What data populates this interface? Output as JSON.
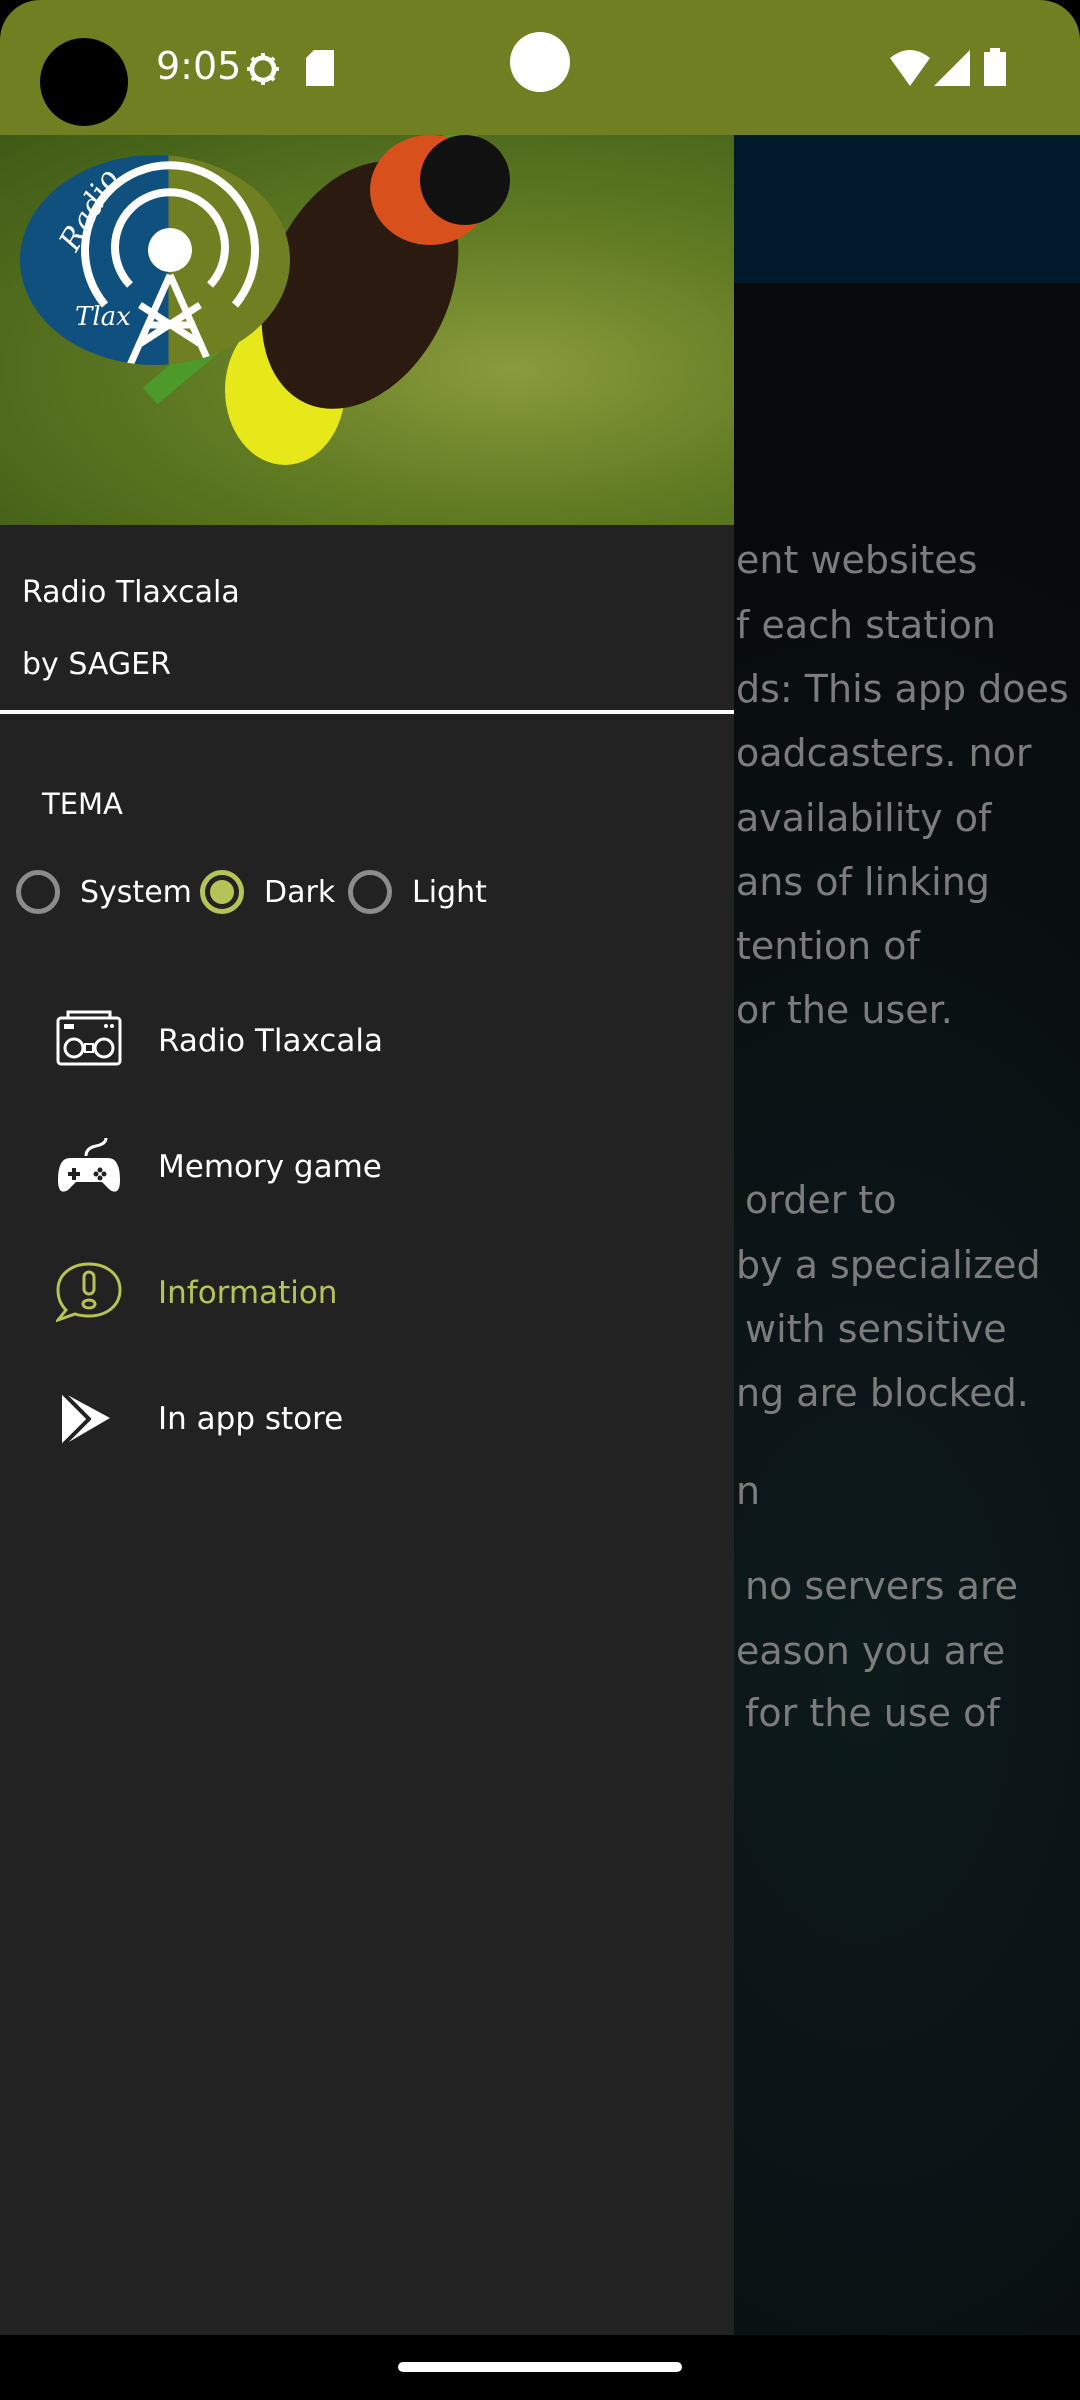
{
  "status_bar": {
    "time": "9:05",
    "icons": [
      "gear-icon",
      "sd-card-icon",
      "wifi-icon",
      "signal-icon",
      "battery-icon"
    ],
    "color": "#6f7f21"
  },
  "drawer": {
    "header": {
      "logo_text": [
        "Radio",
        "Tlax"
      ],
      "title": "Radio Tlaxcala",
      "subtitle": "by SAGER"
    },
    "theme": {
      "label": "TEMA",
      "options": [
        {
          "label": "System",
          "selected": false
        },
        {
          "label": "Dark",
          "selected": true
        },
        {
          "label": "Light",
          "selected": false
        }
      ]
    },
    "menu": [
      {
        "label": "Radio Tlaxcala",
        "icon": "radio-icon",
        "active": false
      },
      {
        "label": "Memory game",
        "icon": "gamepad-icon",
        "active": false
      },
      {
        "label": "Information",
        "icon": "info-bubble-icon",
        "active": true
      },
      {
        "label": "In app store",
        "icon": "play-store-icon",
        "active": false
      }
    ],
    "accent": "#b5c456",
    "background": "#232223"
  },
  "background_text": [
    "ent websites",
    "f each station",
    "ds: This app does",
    "oadcasters. nor",
    "availability of",
    "ans of linking",
    "tention of",
    "or the user.",
    "order to",
    "by a specialized",
    "with sensitive",
    "ng are blocked.",
    "n",
    "no servers are",
    "eason you are",
    "for the use of"
  ]
}
